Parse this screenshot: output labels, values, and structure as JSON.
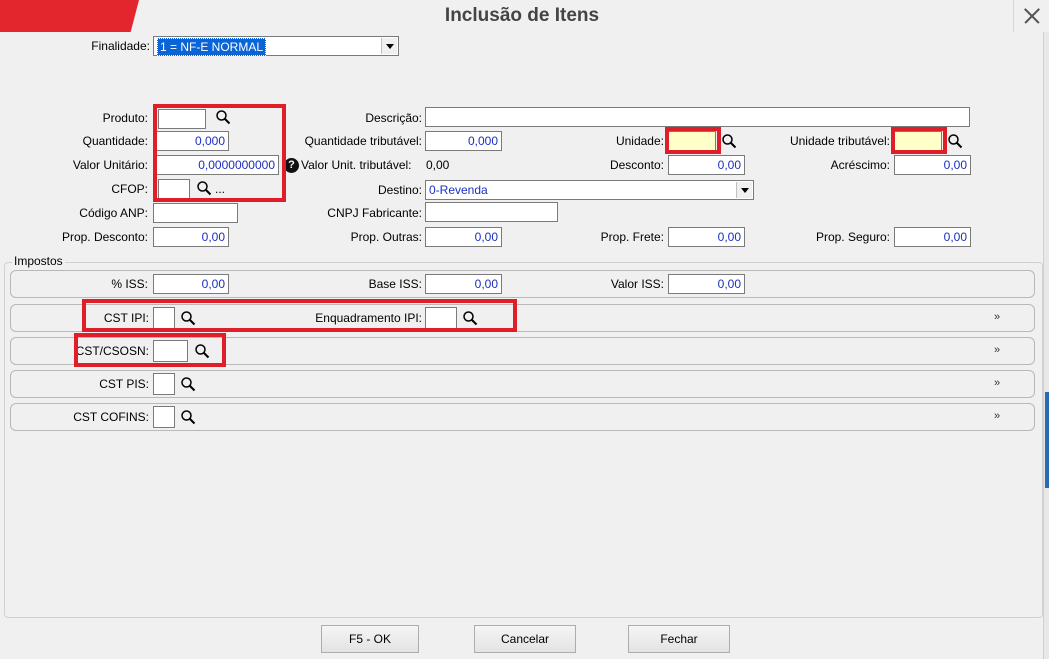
{
  "window": {
    "title": "Inclusão de Itens"
  },
  "finalidade": {
    "label": "Finalidade:",
    "value": "1 = NF-E NORMAL"
  },
  "fields": {
    "produto_label": "Produto:",
    "descricao_label": "Descrição:",
    "quantidade_label": "Quantidade:",
    "quantidade_value": "0,000",
    "qtd_trib_label": "Quantidade tributável:",
    "qtd_trib_value": "0,000",
    "unidade_label": "Unidade:",
    "unidade_trib_label": "Unidade tributável:",
    "valor_unit_label": "Valor Unitário:",
    "valor_unit_value": "0,0000000000",
    "valor_unit_trib_label": "Valor Unit. tributável:",
    "valor_unit_trib_value": "0,00",
    "desconto_label": "Desconto:",
    "desconto_value": "0,00",
    "acrescimo_label": "Acréscimo:",
    "acrescimo_value": "0,00",
    "cfop_label": "CFOP:",
    "cfop_more": "...",
    "destino_label": "Destino:",
    "destino_value": "0-Revenda",
    "codigo_anp_label": "Código ANP:",
    "cnpj_label": "CNPJ Fabricante:",
    "prop_desconto_label": "Prop. Desconto:",
    "prop_desconto_value": "0,00",
    "prop_outras_label": "Prop. Outras:",
    "prop_outras_value": "0,00",
    "prop_frete_label": "Prop. Frete:",
    "prop_frete_value": "0,00",
    "prop_seguro_label": "Prop. Seguro:",
    "prop_seguro_value": "0,00"
  },
  "impostos": {
    "title": "Impostos",
    "iss_label": "% ISS:",
    "iss_value": "0,00",
    "base_iss_label": "Base ISS:",
    "base_iss_value": "0,00",
    "valor_iss_label": "Valor ISS:",
    "valor_iss_value": "0,00",
    "cst_ipi_label": "CST IPI:",
    "enquadramento_label": "Enquadramento IPI:",
    "cst_csosn_label": "CST/CSOSN:",
    "cst_pis_label": "CST PIS:",
    "cst_cofins_label": "CST COFINS:",
    "expand_glyph": "»"
  },
  "buttons": {
    "ok": "F5 - OK",
    "cancel": "Cancelar",
    "close": "Fechar"
  },
  "colors": {
    "accent_red": "#e3262e",
    "highlight_red": "#e01e2a",
    "value_blue": "#1a2fbf"
  }
}
